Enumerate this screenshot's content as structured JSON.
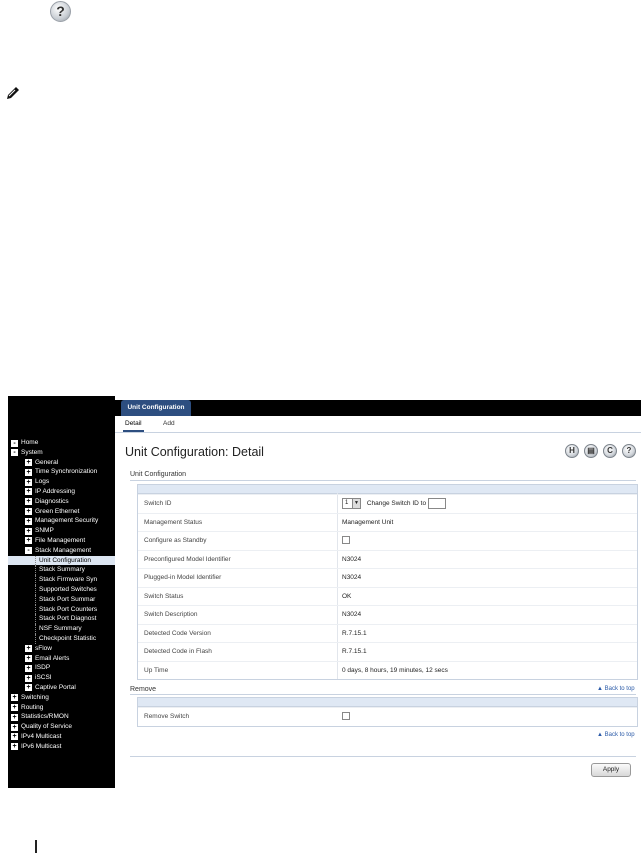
{
  "page": {
    "help_glyph": "?"
  },
  "sidebar": {
    "items": [
      {
        "label": "Home",
        "level": 0,
        "expander": "-"
      },
      {
        "label": "System",
        "level": 0,
        "expander": "-"
      },
      {
        "label": "General",
        "level": 1,
        "expander": "+"
      },
      {
        "label": "Time Synchronization",
        "level": 1,
        "expander": "+"
      },
      {
        "label": "Logs",
        "level": 1,
        "expander": "+"
      },
      {
        "label": "IP Addressing",
        "level": 1,
        "expander": "+"
      },
      {
        "label": "Diagnostics",
        "level": 1,
        "expander": "+"
      },
      {
        "label": "Green Ethernet",
        "level": 1,
        "expander": "+"
      },
      {
        "label": "Management Security",
        "level": 1,
        "expander": "+"
      },
      {
        "label": "SNMP",
        "level": 1,
        "expander": "+"
      },
      {
        "label": "File Management",
        "level": 1,
        "expander": "+"
      },
      {
        "label": "Stack Management",
        "level": 1,
        "expander": "-"
      },
      {
        "label": "Unit Configuration",
        "level": 2,
        "expander": "",
        "selected": true
      },
      {
        "label": "Stack Summary",
        "level": 2,
        "expander": ""
      },
      {
        "label": "Stack Firmware Syn",
        "level": 2,
        "expander": ""
      },
      {
        "label": "Supported Switches",
        "level": 2,
        "expander": ""
      },
      {
        "label": "Stack Port Summar",
        "level": 2,
        "expander": ""
      },
      {
        "label": "Stack Port Counters",
        "level": 2,
        "expander": ""
      },
      {
        "label": "Stack Port Diagnost",
        "level": 2,
        "expander": ""
      },
      {
        "label": "NSF Summary",
        "level": 2,
        "expander": ""
      },
      {
        "label": "Checkpoint Statistic",
        "level": 2,
        "expander": ""
      },
      {
        "label": "sFlow",
        "level": 1,
        "expander": "+"
      },
      {
        "label": "Email Alerts",
        "level": 1,
        "expander": "+"
      },
      {
        "label": "ISDP",
        "level": 1,
        "expander": "+"
      },
      {
        "label": "iSCSI",
        "level": 1,
        "expander": "+"
      },
      {
        "label": "Captive Portal",
        "level": 1,
        "expander": "+"
      },
      {
        "label": "Switching",
        "level": 0,
        "expander": "+"
      },
      {
        "label": "Routing",
        "level": 0,
        "expander": "+"
      },
      {
        "label": "Statistics/RMON",
        "level": 0,
        "expander": "+"
      },
      {
        "label": "Quality of Service",
        "level": 0,
        "expander": "+"
      },
      {
        "label": "IPv4 Multicast",
        "level": 0,
        "expander": "+"
      },
      {
        "label": "IPv6 Multicast",
        "level": 0,
        "expander": "+"
      }
    ]
  },
  "header": {
    "tab_label": "Unit Configuration",
    "subtabs": [
      "Detail",
      "Add"
    ],
    "title": "Unit Configuration: Detail"
  },
  "toolbar": {
    "icons": [
      {
        "name": "save-icon",
        "glyph": "H"
      },
      {
        "name": "print-icon",
        "glyph": "▤"
      },
      {
        "name": "refresh-icon",
        "glyph": "C"
      },
      {
        "name": "help-icon",
        "glyph": "?"
      }
    ]
  },
  "unit_config": {
    "section_title": "Unit Configuration",
    "switch_id_value": "1",
    "change_id_label": "Change Switch ID to",
    "rows": [
      {
        "label": "Switch ID",
        "value": ""
      },
      {
        "label": "Management Status",
        "value": "Management Unit"
      },
      {
        "label": "Configure as Standby",
        "value": ""
      },
      {
        "label": "Preconfigured Model Identifier",
        "value": "N3024"
      },
      {
        "label": "Plugged-in Model Identifier",
        "value": "N3024"
      },
      {
        "label": "Switch Status",
        "value": "OK"
      },
      {
        "label": "Switch Description",
        "value": "N3024"
      },
      {
        "label": "Detected Code Version",
        "value": "R.7.15.1"
      },
      {
        "label": "Detected Code in Flash",
        "value": "R.7.15.1"
      },
      {
        "label": "Up Time",
        "value": "0 days, 8 hours, 19 minutes, 12 secs"
      }
    ]
  },
  "remove": {
    "section_title": "Remove",
    "back_to_top": "▲ Back to top",
    "row_label": "Remove Switch"
  },
  "footer": {
    "back_to_top": "▲ Back to top",
    "apply_label": "Apply"
  }
}
